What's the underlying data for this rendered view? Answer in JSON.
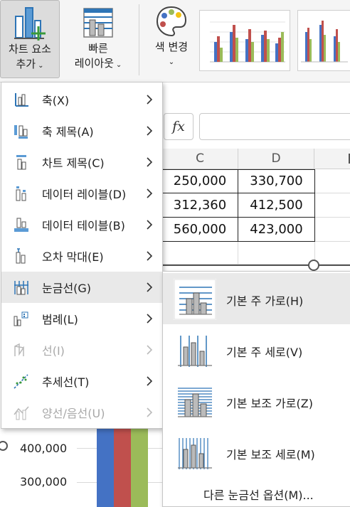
{
  "ribbon": {
    "add_element": {
      "line1": "차트 요소",
      "line2": "추가"
    },
    "quick_layout": {
      "line1": "빠른",
      "line2": "레이아웃"
    },
    "change_colors": {
      "line1": "색 변경"
    },
    "chevron": "⌄",
    "fx_label": "fx"
  },
  "sheet": {
    "columns": [
      "C",
      "D"
    ],
    "rows": [
      [
        "250,000",
        "330,700"
      ],
      [
        "312,360",
        "412,500"
      ],
      [
        "560,000",
        "423,000"
      ]
    ]
  },
  "chart_data": {
    "type": "bar",
    "ytick_labels": [
      "400,000",
      "300,000"
    ],
    "series_colors": [
      "#4472c4",
      "#c0504d",
      "#9bbb59"
    ]
  },
  "menu": {
    "items": [
      {
        "label": "축(X)",
        "icon": "axes-icon",
        "disabled": false
      },
      {
        "label": "축 제목(A)",
        "icon": "axis-titles-icon",
        "disabled": false
      },
      {
        "label": "차트 제목(C)",
        "icon": "chart-title-icon",
        "disabled": false
      },
      {
        "label": "데이터 레이블(D)",
        "icon": "data-labels-icon",
        "disabled": false
      },
      {
        "label": "데이터 테이블(B)",
        "icon": "data-table-icon",
        "disabled": false
      },
      {
        "label": "오차 막대(E)",
        "icon": "error-bars-icon",
        "disabled": false
      },
      {
        "label": "눈금선(G)",
        "icon": "gridlines-icon",
        "disabled": false,
        "highlighted": true
      },
      {
        "label": "범례(L)",
        "icon": "legend-icon",
        "disabled": false
      },
      {
        "label": "선(I)",
        "icon": "lines-icon",
        "disabled": true
      },
      {
        "label": "추세선(T)",
        "icon": "trendline-icon",
        "disabled": false
      },
      {
        "label": "양선/음선(U)",
        "icon": "up-down-bars-icon",
        "disabled": true
      }
    ]
  },
  "submenu": {
    "items": [
      {
        "label": "기본 주 가로(H)",
        "icon": "primary-major-horizontal-icon"
      },
      {
        "label": "기본 주 세로(V)",
        "icon": "primary-major-vertical-icon"
      },
      {
        "label": "기본 보조 가로(Z)",
        "icon": "primary-minor-horizontal-icon"
      },
      {
        "label": "기본 보조 세로(M)",
        "icon": "primary-minor-vertical-icon"
      }
    ],
    "more_options": "다른 눈금선 옵션(M)..."
  },
  "colors": {
    "accent_blue": "#2e75b6",
    "accent_green": "#3a9a3a",
    "menu_highlight": "#e9e9e9",
    "disabled_text": "#a8a8a8"
  }
}
